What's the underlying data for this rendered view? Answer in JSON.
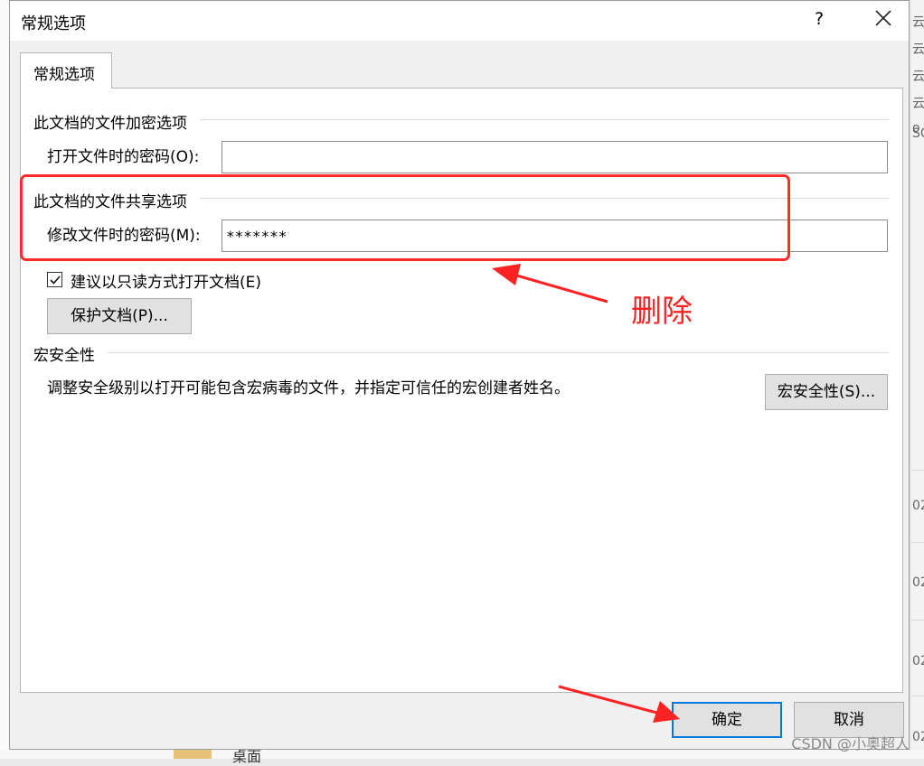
{
  "background": {
    "right_fragments": [
      "云",
      "云",
      "云",
      "云",
      "o",
      "SC",
      "02",
      "02",
      "02",
      "02"
    ],
    "folder_label": "桌面",
    "watermark": "CSDN @小奥超人"
  },
  "dialog": {
    "title": "常规选项",
    "help_glyph": "?",
    "tab_label": "常规选项",
    "encrypt_group": {
      "title": "此文档的文件加密选项",
      "open_password_label": "打开文件时的密码(O):",
      "open_password_value": ""
    },
    "share_group": {
      "title": "此文档的文件共享选项",
      "modify_password_label": "修改文件时的密码(M):",
      "modify_password_value": "*******"
    },
    "readonly_checkbox": {
      "label": "建议以只读方式打开文档(E)",
      "checked": true
    },
    "protect_button": "保护文档(P)...",
    "macro_group": {
      "title": "宏安全性",
      "description": "调整安全级别以打开可能包含宏病毒的文件，并指定可信任的宏创建者姓名。",
      "button": "宏安全性(S)..."
    },
    "ok_button": "确定",
    "cancel_button": "取消"
  },
  "annotation": {
    "text": "删除",
    "color": "#ff2222"
  },
  "colors": {
    "primary_button_border": "#0078d7",
    "annotation_red": "#ff2b2b"
  }
}
